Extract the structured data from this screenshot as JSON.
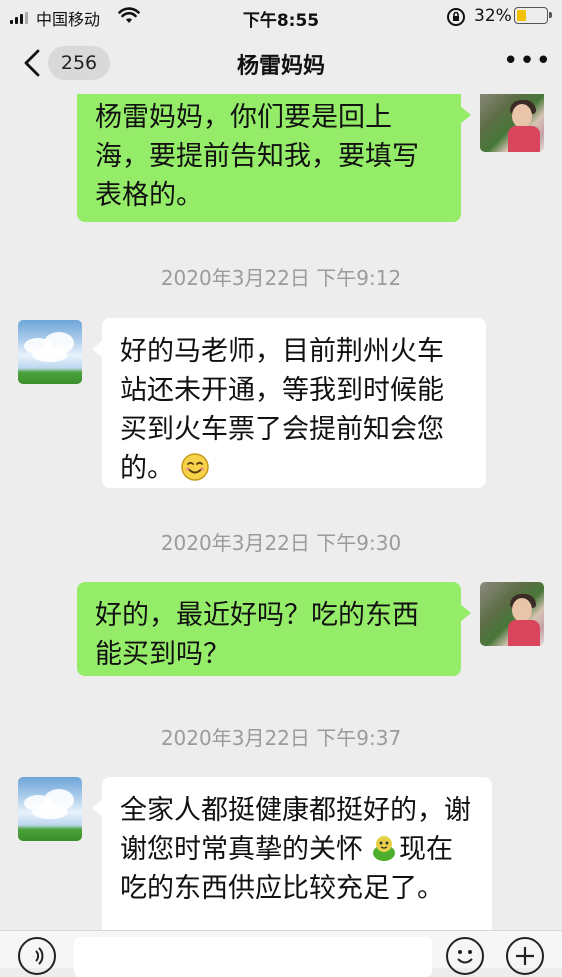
{
  "status_bar": {
    "carrier": "中国移动",
    "time": "下午8:55",
    "battery_percent": "32%",
    "battery_level": 0.32,
    "battery_color": "#f2c200"
  },
  "header": {
    "unread_count": "256",
    "title": "杨雷妈妈",
    "more_icon": "ellipsis-icon",
    "back_icon": "chevron-left-icon"
  },
  "colors": {
    "self_bubble": "#95ec69",
    "other_bubble": "#ffffff",
    "background": "#ededed"
  },
  "messages": [
    {
      "type": "bubble",
      "side": "right",
      "text": "杨雷妈妈，你们要是回上海，要提前告知我，要填写表格的。"
    },
    {
      "type": "time",
      "text": "2020年3月22日 下午9:12"
    },
    {
      "type": "bubble",
      "side": "left",
      "text": "好的马老师，目前荆州火车站还未开通，等我到时候能买到火车票了会提前知会您的。",
      "emoji": "smile-emoji"
    },
    {
      "type": "time",
      "text": "2020年3月22日 下午9:30"
    },
    {
      "type": "bubble",
      "side": "right",
      "text": "好的，最近好吗？吃的东西能买到吗？"
    },
    {
      "type": "time",
      "text": "2020年3月22日 下午9:37"
    },
    {
      "type": "bubble",
      "side": "left",
      "text_before_emoji": "全家人都挺健康都挺好的，谢谢您时常真挚的关怀",
      "emoji": "frog-emoji",
      "text_after_emoji": "现在吃的东西供应比较充足了。"
    }
  ],
  "input_bar": {
    "voice_icon": "voice-icon",
    "emoji_icon": "emoji-icon",
    "plus_icon": "plus-icon"
  }
}
